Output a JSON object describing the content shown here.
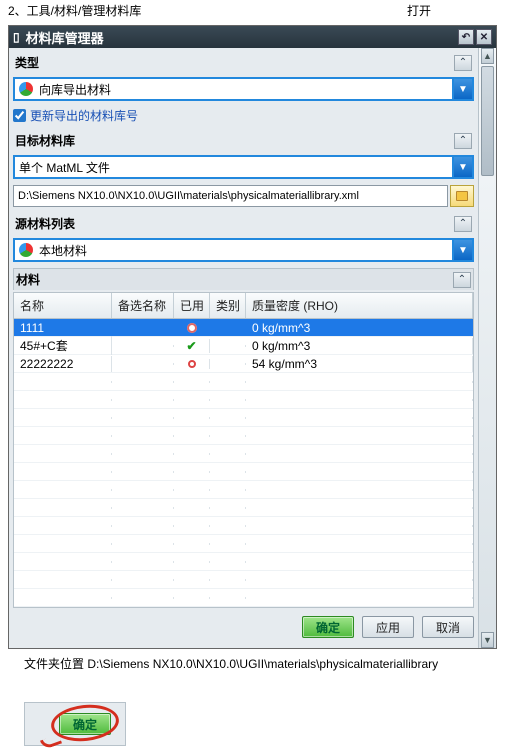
{
  "heading": {
    "menu_path": "2、工具/材料/管理材料库",
    "open_label": "打开"
  },
  "titlebar": {
    "title": "材料库管理器"
  },
  "section_type_label": "类型",
  "type_combo_value": "向库导出材料",
  "checkbox_label": "更新导出的材料库号",
  "target_section_label": "目标材料库",
  "target_combo_value": "单个 MatML 文件",
  "target_path": "D:\\Siemens NX10.0\\NX10.0\\UGII\\materials\\physicalmateriallibrary.xml",
  "source_section_label": "源材料列表",
  "source_combo_value": "本地材料",
  "material_section_label": "材料",
  "columns": {
    "name": "名称",
    "alt": "备选名称",
    "used": "已用",
    "cat": "类别",
    "density": "质量密度 (RHO)"
  },
  "rows": [
    {
      "name": "1111",
      "alt": "",
      "used": "dot",
      "cat": "",
      "density": "0 kg/mm^3",
      "selected": true
    },
    {
      "name": "45#+C套",
      "alt": "",
      "used": "check",
      "cat": "",
      "density": "0 kg/mm^3",
      "selected": false
    },
    {
      "name": "22222222",
      "alt": "",
      "used": "ring",
      "cat": "",
      "density": "54 kg/mm^3",
      "selected": false
    }
  ],
  "buttons": {
    "ok": "确定",
    "apply": "应用",
    "cancel": "取消"
  },
  "footnote": "文件夹位置 D:\\Siemens NX10.0\\NX10.0\\UGII\\materials\\physicalmateriallibrary",
  "snippet_ok": "确定"
}
